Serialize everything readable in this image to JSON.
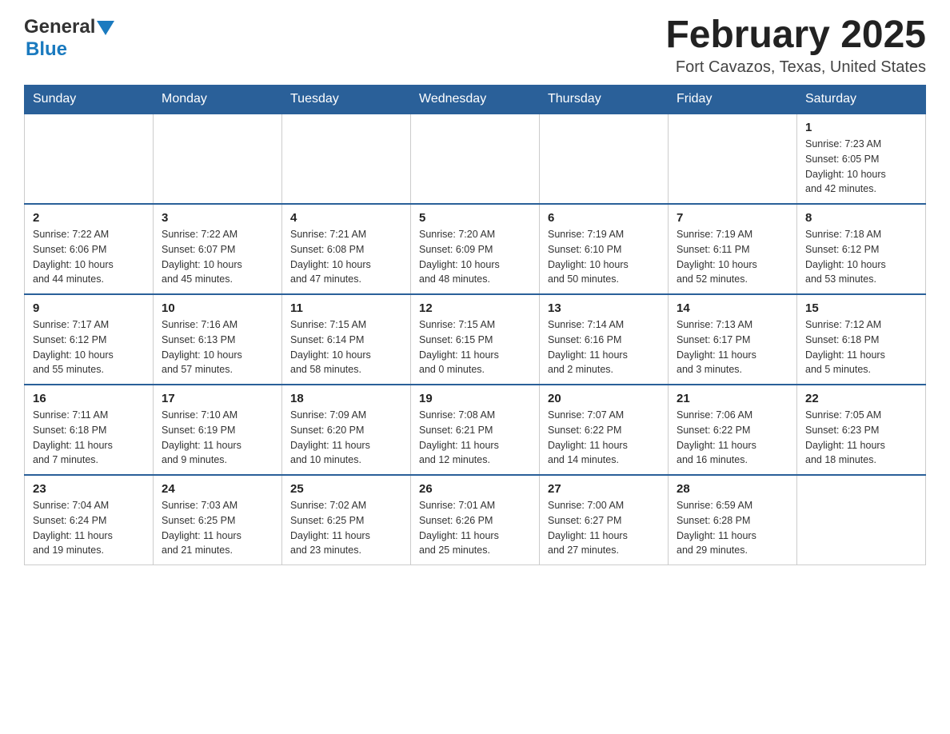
{
  "header": {
    "logo_general": "General",
    "logo_blue": "Blue",
    "month_title": "February 2025",
    "location": "Fort Cavazos, Texas, United States"
  },
  "days_of_week": [
    "Sunday",
    "Monday",
    "Tuesday",
    "Wednesday",
    "Thursday",
    "Friday",
    "Saturday"
  ],
  "weeks": [
    [
      {
        "day": "",
        "info": ""
      },
      {
        "day": "",
        "info": ""
      },
      {
        "day": "",
        "info": ""
      },
      {
        "day": "",
        "info": ""
      },
      {
        "day": "",
        "info": ""
      },
      {
        "day": "",
        "info": ""
      },
      {
        "day": "1",
        "info": "Sunrise: 7:23 AM\nSunset: 6:05 PM\nDaylight: 10 hours\nand 42 minutes."
      }
    ],
    [
      {
        "day": "2",
        "info": "Sunrise: 7:22 AM\nSunset: 6:06 PM\nDaylight: 10 hours\nand 44 minutes."
      },
      {
        "day": "3",
        "info": "Sunrise: 7:22 AM\nSunset: 6:07 PM\nDaylight: 10 hours\nand 45 minutes."
      },
      {
        "day": "4",
        "info": "Sunrise: 7:21 AM\nSunset: 6:08 PM\nDaylight: 10 hours\nand 47 minutes."
      },
      {
        "day": "5",
        "info": "Sunrise: 7:20 AM\nSunset: 6:09 PM\nDaylight: 10 hours\nand 48 minutes."
      },
      {
        "day": "6",
        "info": "Sunrise: 7:19 AM\nSunset: 6:10 PM\nDaylight: 10 hours\nand 50 minutes."
      },
      {
        "day": "7",
        "info": "Sunrise: 7:19 AM\nSunset: 6:11 PM\nDaylight: 10 hours\nand 52 minutes."
      },
      {
        "day": "8",
        "info": "Sunrise: 7:18 AM\nSunset: 6:12 PM\nDaylight: 10 hours\nand 53 minutes."
      }
    ],
    [
      {
        "day": "9",
        "info": "Sunrise: 7:17 AM\nSunset: 6:12 PM\nDaylight: 10 hours\nand 55 minutes."
      },
      {
        "day": "10",
        "info": "Sunrise: 7:16 AM\nSunset: 6:13 PM\nDaylight: 10 hours\nand 57 minutes."
      },
      {
        "day": "11",
        "info": "Sunrise: 7:15 AM\nSunset: 6:14 PM\nDaylight: 10 hours\nand 58 minutes."
      },
      {
        "day": "12",
        "info": "Sunrise: 7:15 AM\nSunset: 6:15 PM\nDaylight: 11 hours\nand 0 minutes."
      },
      {
        "day": "13",
        "info": "Sunrise: 7:14 AM\nSunset: 6:16 PM\nDaylight: 11 hours\nand 2 minutes."
      },
      {
        "day": "14",
        "info": "Sunrise: 7:13 AM\nSunset: 6:17 PM\nDaylight: 11 hours\nand 3 minutes."
      },
      {
        "day": "15",
        "info": "Sunrise: 7:12 AM\nSunset: 6:18 PM\nDaylight: 11 hours\nand 5 minutes."
      }
    ],
    [
      {
        "day": "16",
        "info": "Sunrise: 7:11 AM\nSunset: 6:18 PM\nDaylight: 11 hours\nand 7 minutes."
      },
      {
        "day": "17",
        "info": "Sunrise: 7:10 AM\nSunset: 6:19 PM\nDaylight: 11 hours\nand 9 minutes."
      },
      {
        "day": "18",
        "info": "Sunrise: 7:09 AM\nSunset: 6:20 PM\nDaylight: 11 hours\nand 10 minutes."
      },
      {
        "day": "19",
        "info": "Sunrise: 7:08 AM\nSunset: 6:21 PM\nDaylight: 11 hours\nand 12 minutes."
      },
      {
        "day": "20",
        "info": "Sunrise: 7:07 AM\nSunset: 6:22 PM\nDaylight: 11 hours\nand 14 minutes."
      },
      {
        "day": "21",
        "info": "Sunrise: 7:06 AM\nSunset: 6:22 PM\nDaylight: 11 hours\nand 16 minutes."
      },
      {
        "day": "22",
        "info": "Sunrise: 7:05 AM\nSunset: 6:23 PM\nDaylight: 11 hours\nand 18 minutes."
      }
    ],
    [
      {
        "day": "23",
        "info": "Sunrise: 7:04 AM\nSunset: 6:24 PM\nDaylight: 11 hours\nand 19 minutes."
      },
      {
        "day": "24",
        "info": "Sunrise: 7:03 AM\nSunset: 6:25 PM\nDaylight: 11 hours\nand 21 minutes."
      },
      {
        "day": "25",
        "info": "Sunrise: 7:02 AM\nSunset: 6:25 PM\nDaylight: 11 hours\nand 23 minutes."
      },
      {
        "day": "26",
        "info": "Sunrise: 7:01 AM\nSunset: 6:26 PM\nDaylight: 11 hours\nand 25 minutes."
      },
      {
        "day": "27",
        "info": "Sunrise: 7:00 AM\nSunset: 6:27 PM\nDaylight: 11 hours\nand 27 minutes."
      },
      {
        "day": "28",
        "info": "Sunrise: 6:59 AM\nSunset: 6:28 PM\nDaylight: 11 hours\nand 29 minutes."
      },
      {
        "day": "",
        "info": ""
      }
    ]
  ]
}
